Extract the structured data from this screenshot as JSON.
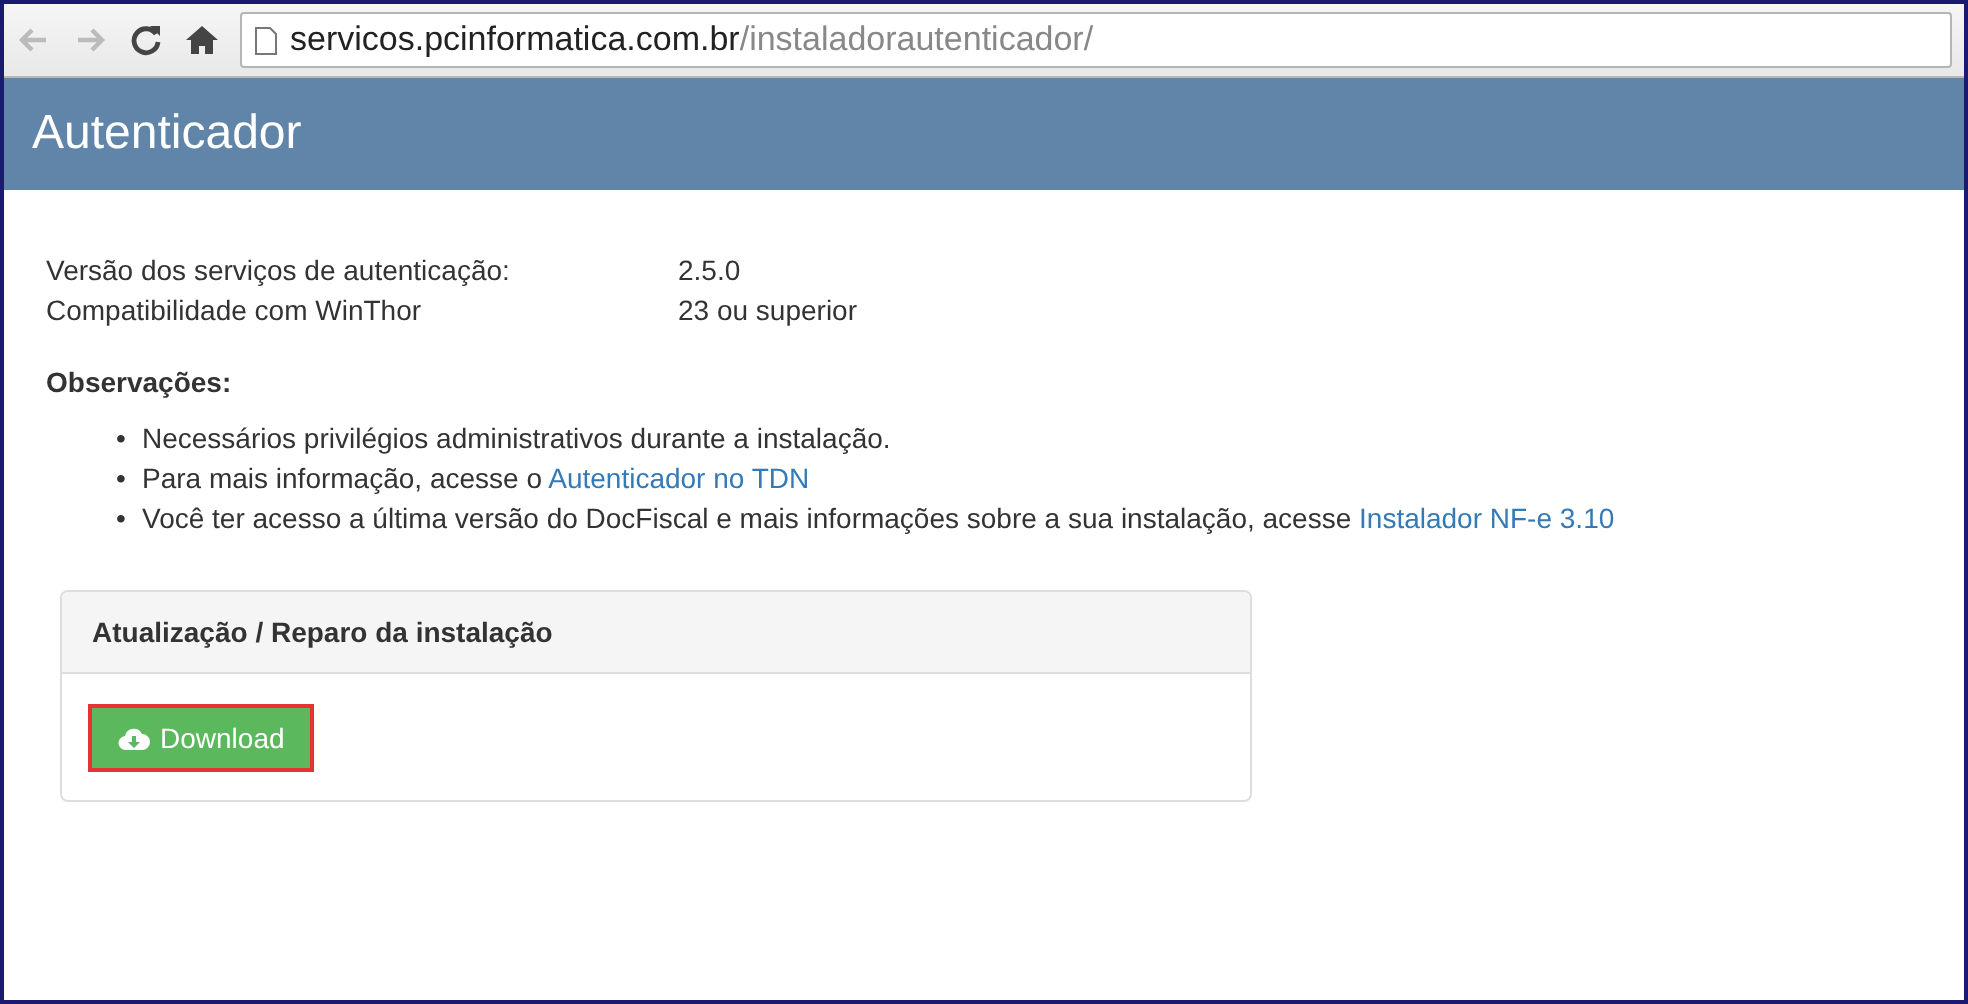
{
  "browser": {
    "url_host": "servicos.pcinformatica.com.br",
    "url_path": "/instaladorautenticador/"
  },
  "header": {
    "title": "Autenticador"
  },
  "info": [
    {
      "label": "Versão dos serviços de autenticação:",
      "value": "2.5.0"
    },
    {
      "label": "Compatibilidade com WinThor",
      "value": "23 ou superior"
    }
  ],
  "notes": {
    "title": "Observações:",
    "items": [
      {
        "bullet": "•",
        "text": "Necessários privilégios administrativos durante a instalação."
      },
      {
        "bullet": "•",
        "text": "Para mais informação, acesse o ",
        "link": "Autenticador no TDN"
      },
      {
        "bullet": "•",
        "text": "Você ter acesso a última versão do DocFiscal e mais informações sobre a sua instalação, acesse ",
        "link": "Instalador NF-e 3.10"
      }
    ]
  },
  "panel": {
    "title": "Atualização / Reparo da instalação",
    "button": {
      "label": "Download",
      "highlighted": true
    }
  }
}
